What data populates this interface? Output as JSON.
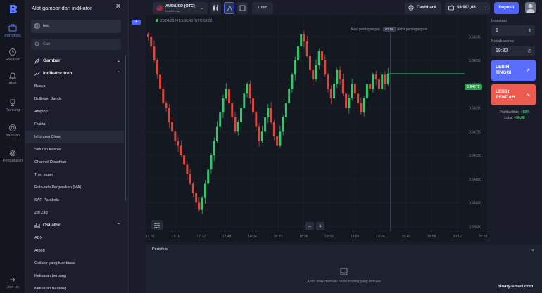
{
  "rail": {
    "items": [
      {
        "label": "Portofolio",
        "icon": "portfolio-icon",
        "active": true
      },
      {
        "label": "Riwayat",
        "icon": "history-icon"
      },
      {
        "label": "Alert",
        "icon": "bell-icon"
      },
      {
        "label": "Ranking",
        "icon": "trophy-icon"
      },
      {
        "label": "Bantuan",
        "icon": "help-icon"
      },
      {
        "label": "Pengaturan",
        "icon": "gear-icon"
      }
    ],
    "bottom_label": "Join us"
  },
  "panel": {
    "title": "Alat gambar dan indikator",
    "template_label": "test",
    "add_label": "+",
    "search_placeholder": "Cari",
    "section_drawing": "Gambar",
    "section_trend": "Indikator tren",
    "trend_items": [
      "Buaya",
      "Bollinger Bands",
      "Amplop",
      "Fraktal",
      "Ichimoku Cloud",
      "Saluran Keltner",
      "Channel Donchian",
      "Tren super",
      "Rata-rata Pergerakan (MA)",
      "SAR Parabola",
      "Zig Zag"
    ],
    "selected_item": "Ichimoku Cloud",
    "section_oscillator": "Osilator",
    "oscillator_items": [
      "ADX",
      "Aroon",
      "Osilator yang luar biasa",
      "Kekuatan beruang",
      "Kekuatan Banteng"
    ]
  },
  "topbar": {
    "asset_name": "AUD/USD (OTC)",
    "asset_sub": "Waktu tetap",
    "timeframe": "1 mnt",
    "cashback": "Cashback",
    "balance": "$9.993,66",
    "deposit": "Deposit"
  },
  "chart": {
    "datetime": "20/04/2024  19:30:43  (UTC-03:00)",
    "trade_start_label": "Awal perdagangan",
    "trade_timer": "01:16",
    "trade_end_label": "Akhir perdagangan",
    "current_price": "0.64272"
  },
  "chart_data": {
    "type": "candlestick",
    "y_ticks": [
      "0.64350",
      "0.64300",
      "0.64250",
      "0.64200",
      "0.64150",
      "0.64100",
      "0.64050",
      "0.64000",
      "0.63950"
    ],
    "x_ticks": [
      "17:00",
      "17:16",
      "17:32",
      "17:48",
      "18:04",
      "18:20",
      "18:36",
      "18:52",
      "19:08",
      "19:24",
      "19:40",
      "19:56",
      "20:12",
      "20:28"
    ],
    "ylim": [
      0.6394,
      0.6438
    ],
    "closes": [
      0.6435,
      0.6433,
      0.643,
      0.6427,
      0.6424,
      0.6421,
      0.642,
      0.6417,
      0.6415,
      0.6413,
      0.6412,
      0.641,
      0.6408,
      0.6406,
      0.6404,
      0.6402,
      0.64,
      0.63985,
      0.6401,
      0.6404,
      0.6407,
      0.641,
      0.6413,
      0.6416,
      0.6419,
      0.6422,
      0.6424,
      0.6421,
      0.6418,
      0.6415,
      0.6417,
      0.642,
      0.6423,
      0.6425,
      0.6422,
      0.6419,
      0.6416,
      0.6413,
      0.6415,
      0.6418,
      0.642,
      0.6417,
      0.6414,
      0.6412,
      0.6415,
      0.6418,
      0.6421,
      0.6424,
      0.6427,
      0.643,
      0.6433,
      0.64355,
      0.6434,
      0.6431,
      0.6428,
      0.6426,
      0.6429,
      0.6432,
      0.643,
      0.6427,
      0.6424,
      0.6422,
      0.6425,
      0.6428,
      0.6426,
      0.6423,
      0.642,
      0.6422,
      0.6425,
      0.6423,
      0.6421,
      0.6419,
      0.6422,
      0.6425,
      0.6424,
      0.6427,
      0.6426,
      0.6424,
      0.6427,
      0.6425,
      0.64272
    ]
  },
  "trade": {
    "investment_label": "Investasi",
    "investment_value": "1",
    "expiry_label": "Kedaluwarsa",
    "expiry_value": "19:32",
    "up_label": "LEBIH TINGGI",
    "down_label": "LEBIH RENDAH",
    "profitability_label": "Profitabilitas:",
    "profitability_value": "+88%",
    "profit_label": "Laba:",
    "profit_value": "+$0,88"
  },
  "portfolio": {
    "title": "Portofolio",
    "empty_text": "Anda tidak memiliki posisi trading yang terbuka"
  },
  "watermark": "binary-smart.com",
  "colors": {
    "accent": "#4f63ff",
    "up": "#35c86a",
    "down": "#ec5b50",
    "chart_bg": "#141821"
  }
}
